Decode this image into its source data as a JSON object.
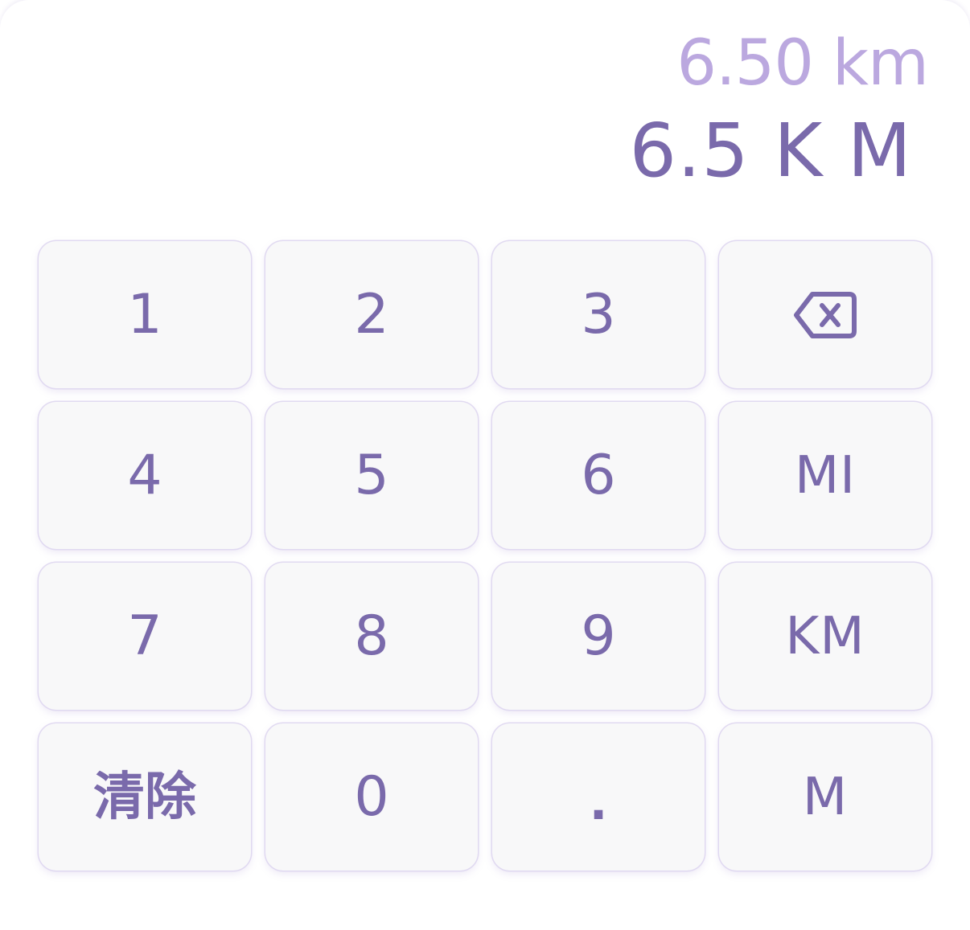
{
  "display": {
    "secondary": "6.50 km",
    "primary": "6.5 K M"
  },
  "keys": {
    "k1": "1",
    "k2": "2",
    "k3": "3",
    "k4": "4",
    "k5": "5",
    "k6": "6",
    "k7": "7",
    "k8": "8",
    "k9": "9",
    "k0": "0",
    "dot": ".",
    "clear": "清除",
    "mi": "MI",
    "km": "KM",
    "m": "M",
    "backspace_icon": "backspace-icon"
  },
  "colors": {
    "accent": "#7a6aab",
    "secondary_text": "#bba8df",
    "key_background": "#f8f8f9"
  }
}
